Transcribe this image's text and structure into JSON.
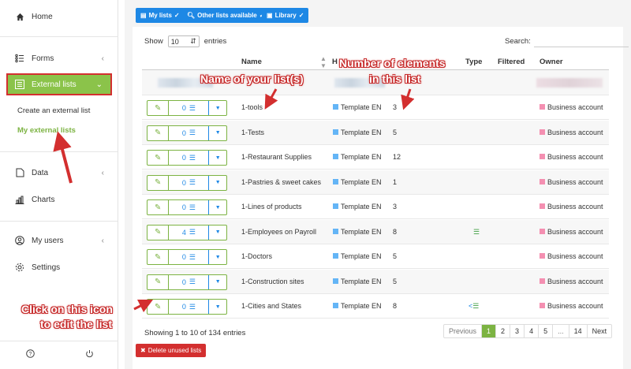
{
  "sidebar": {
    "home": "Home",
    "forms": "Forms",
    "external_lists": "External lists",
    "create_external_list": "Create an external list",
    "my_external_lists": "My external lists",
    "data": "Data",
    "charts": "Charts",
    "my_users": "My users",
    "settings": "Settings"
  },
  "toolbar": {
    "my_lists": "My lists",
    "other_lists": "Other lists available",
    "library": "Library"
  },
  "table_controls": {
    "show_label": "Show",
    "entries_value": "10",
    "entries_label": "entries",
    "search_label": "Search:",
    "search_value": ""
  },
  "columns": {
    "name": "Name",
    "h": "H",
    "type": "Type",
    "filtered": "Filtered",
    "owner": "Owner"
  },
  "rows": [
    {
      "count": "0",
      "name": "1-tools",
      "template": "Template EN",
      "elements": "3",
      "type": "",
      "owner": "Business account"
    },
    {
      "count": "0",
      "name": "1-Tests",
      "template": "Template EN",
      "elements": "5",
      "type": "",
      "owner": "Business account"
    },
    {
      "count": "0",
      "name": "1-Restaurant Supplies",
      "template": "Template EN",
      "elements": "12",
      "type": "",
      "owner": "Business account"
    },
    {
      "count": "0",
      "name": "1-Pastries & sweet cakes",
      "template": "Template EN",
      "elements": "1",
      "type": "",
      "owner": "Business account"
    },
    {
      "count": "0",
      "name": "1-Lines of products",
      "template": "Template EN",
      "elements": "3",
      "type": "",
      "owner": "Business account"
    },
    {
      "count": "4",
      "name": "1-Employees on Payroll",
      "template": "Template EN",
      "elements": "8",
      "type": "list",
      "owner": "Business account"
    },
    {
      "count": "0",
      "name": "1-Doctors",
      "template": "Template EN",
      "elements": "5",
      "type": "",
      "owner": "Business account"
    },
    {
      "count": "0",
      "name": "1-Construction sites",
      "template": "Template EN",
      "elements": "5",
      "type": "",
      "owner": "Business account"
    },
    {
      "count": "0",
      "name": "1-Cities and States",
      "template": "Template EN",
      "elements": "8",
      "type": "share-list",
      "owner": "Business account"
    }
  ],
  "footer": {
    "showing": "Showing 1 to 10 of 134 entries",
    "delete_unused": "Delete unused lists"
  },
  "pagination": {
    "previous": "Previous",
    "pages": [
      "1",
      "2",
      "3",
      "4",
      "5",
      "...",
      "14"
    ],
    "next": "Next",
    "active_page": "1"
  },
  "annotations": {
    "name_of_list": "Name of your list(s)",
    "number_elements_1": "Number of elements",
    "number_elements_2": "in this list",
    "click_icon_1": "Click on this icon",
    "click_icon_2": "to edit the list"
  },
  "colors": {
    "accent_green": "#7cb342",
    "accent_blue": "#1e88e5",
    "annotation_red": "#c62828",
    "delete_red": "#d32f2f"
  }
}
